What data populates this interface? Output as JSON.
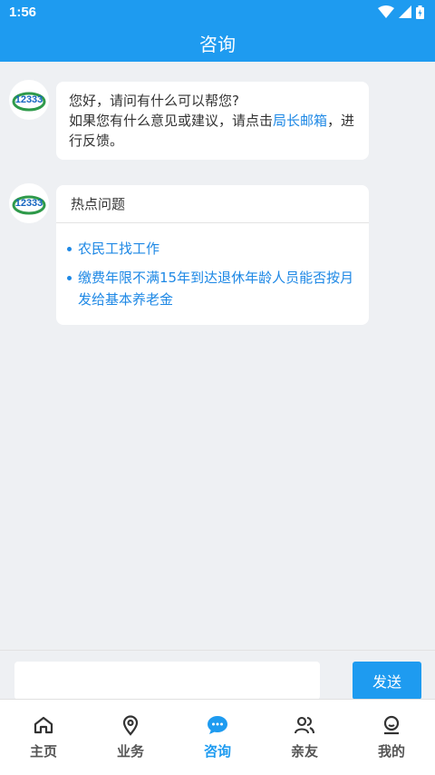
{
  "status": {
    "time": "1:56"
  },
  "header": {
    "title": "咨询"
  },
  "chat": {
    "avatar_text": "12333",
    "greeting": {
      "line1": "您好，请问有什么可以帮您?",
      "line2_prefix": "如果您有什么意见或建议，请点击",
      "line2_link": "局长邮箱",
      "line2_suffix": "，进",
      "line3": "行反馈。"
    },
    "hot": {
      "title": "热点问题",
      "questions": [
        {
          "line1": "农民工找工作"
        },
        {
          "line1": "缴费年限不满15年到达退休年龄人员能否按月",
          "line2": "发给基本养老金"
        }
      ]
    }
  },
  "input": {
    "value": "",
    "send_label": "发送"
  },
  "tabs": [
    {
      "label": "主页",
      "icon": "home-icon"
    },
    {
      "label": "业务",
      "icon": "location-icon"
    },
    {
      "label": "咨询",
      "icon": "chat-icon",
      "active": true
    },
    {
      "label": "亲友",
      "icon": "people-icon"
    },
    {
      "label": "我的",
      "icon": "user-icon"
    }
  ],
  "colors": {
    "primary": "#1e9bf0",
    "link": "#1e88e5",
    "background": "#eef0f3"
  }
}
